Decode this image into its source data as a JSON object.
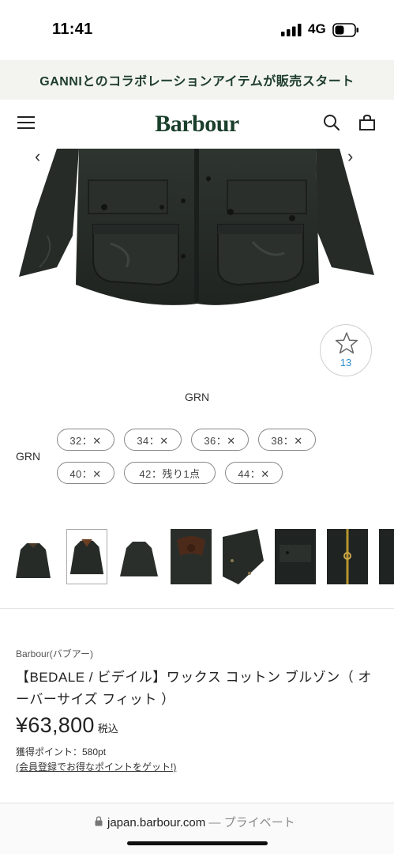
{
  "status_bar": {
    "time": "11:41",
    "network": "4G"
  },
  "promo": {
    "text": "GANNIとのコラボレーションアイテムが販売スタート"
  },
  "header": {
    "logo": "Barbour"
  },
  "gallery": {
    "prev": "‹",
    "next": "›",
    "favorite_count": "13"
  },
  "color": {
    "name": "GRN"
  },
  "sizes": {
    "row_label": "GRN",
    "items": [
      {
        "label": "32：✕"
      },
      {
        "label": "34：✕"
      },
      {
        "label": "36：✕"
      },
      {
        "label": "38：✕"
      },
      {
        "label": "40：✕"
      },
      {
        "label": "42：残り1点"
      },
      {
        "label": "44：✕"
      }
    ]
  },
  "product": {
    "brand": "Barbour(バブアー)",
    "title": "【BEDALE / ビデイル】ワックス コットン ブルゾン（ オーバーサイズ フィット ）",
    "price": "¥63,800",
    "tax": "税込",
    "points": "獲得ポイント：580pt",
    "points_link": "(会員登録でお得なポイントをゲット!)"
  },
  "address_bar": {
    "domain": "japan.barbour.com",
    "separator": " — ",
    "mode": "プライベート"
  },
  "colors": {
    "brand_green": "#1a3f2b",
    "promo_bg": "#f3f4f0",
    "link_blue": "#2a8ccf"
  }
}
